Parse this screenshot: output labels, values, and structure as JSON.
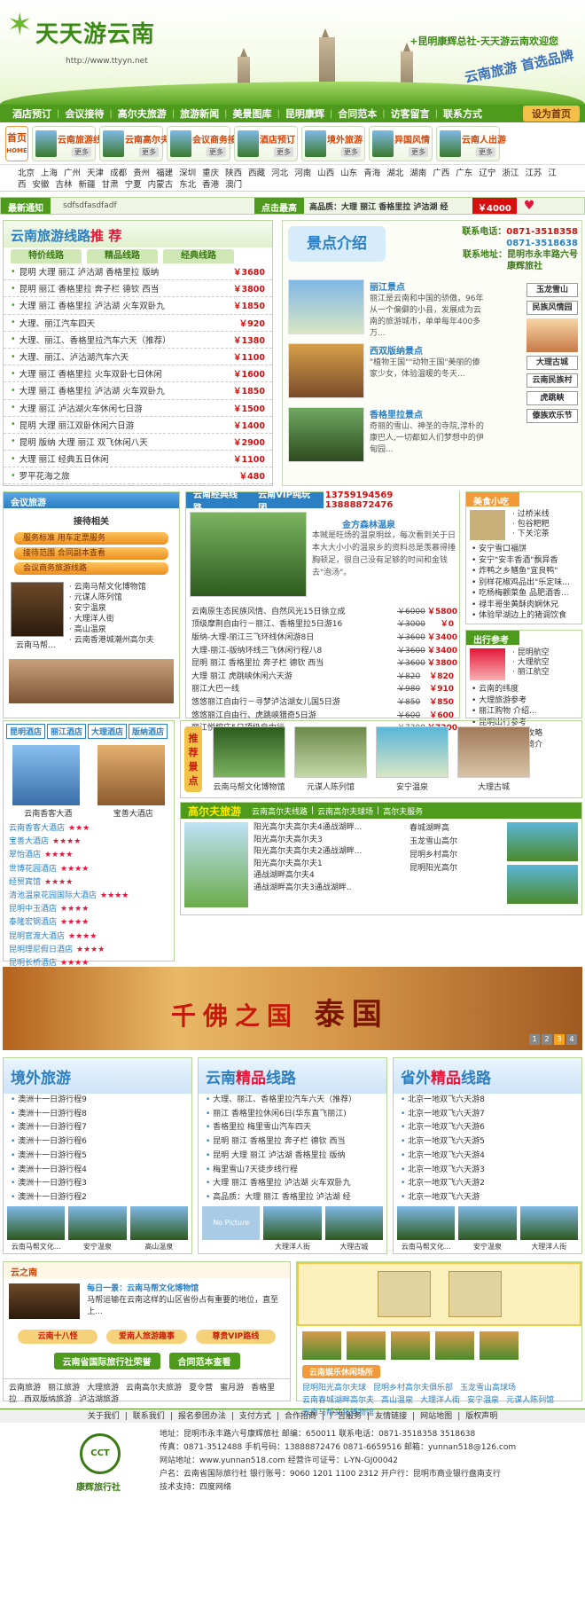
{
  "header": {
    "logo_text": "天天游云南",
    "logo_url": "http://www.ttyyn.net",
    "welcome": "+昆明康辉总社-天天游云南欢迎您",
    "slogan": "云南旅游 首选品牌"
  },
  "nav": {
    "items": [
      "酒店预订",
      "会议接待",
      "高尔夫旅游",
      "旅游新闻",
      "美景图库",
      "昆明康辉",
      "合同范本",
      "访客留言",
      "联系方式"
    ],
    "home": "设为首页"
  },
  "quick": {
    "home": "首页",
    "home2": "HOME",
    "boxes": [
      "云南旅游线路",
      "云南高尔夫",
      "会议商务接待",
      "酒店预订",
      "境外旅游",
      "异国风情",
      "云南人出游"
    ],
    "more": "更多"
  },
  "cities": [
    "北京",
    "上海",
    "广州",
    "天津",
    "成都",
    "贵州",
    "福建",
    "深圳",
    "重庆",
    "陕西",
    "西藏",
    "河北",
    "河南",
    "山西",
    "山东",
    "青海",
    "湖北",
    "湖南",
    "广西",
    "广东",
    "辽宁",
    "浙江",
    "江苏",
    "江西",
    "安徽",
    "吉林",
    "新疆",
    "甘肃",
    "宁夏",
    "内蒙古",
    "东北",
    "香港",
    "澳门"
  ],
  "notice": {
    "label": "最新通知",
    "value": "sdfsdfasdfadf",
    "hot": "点击最高",
    "hot_value": "高品质：大理 丽江 香格里拉 泸沽湖 经",
    "price": "￥4000"
  },
  "yn_routes": {
    "title1": "云南旅游线路",
    "title2": "推 荐",
    "tabs": [
      "特价线路",
      "精品线路",
      "经典线路"
    ],
    "items": [
      {
        "name": "昆明 大理 丽江 泸沽湖 香格里拉 版纳",
        "price": "￥3680"
      },
      {
        "name": "昆明 丽江 香格里拉 奔子栏 德钦 西当",
        "price": "￥3800"
      },
      {
        "name": "大理 丽江 香格里拉 泸沽湖 火车双卧九",
        "price": "￥1850"
      },
      {
        "name": "大理、丽江汽车四天",
        "price": "￥920"
      },
      {
        "name": "大理、丽江、香格里拉汽车六天（推荐）",
        "price": "￥1380"
      },
      {
        "name": "大理、丽江、泸沽湖汽车六天",
        "price": "￥1100"
      },
      {
        "name": "大理 丽江 香格里拉 火车双卧七日休闲",
        "price": "￥1600"
      },
      {
        "name": "大理 丽江 香格里拉 泸沽湖 火车双卧九",
        "price": "￥1850"
      },
      {
        "name": "大理 丽江 泸沽湖火车休闲七日游",
        "price": "￥1500"
      },
      {
        "name": "昆明 大理 丽江双卧休闲六日游",
        "price": "￥1400"
      },
      {
        "name": "昆明 版纳 大理 丽江 双飞休闲八天",
        "price": "￥2900"
      },
      {
        "name": "大理 丽江 经典五日休闲",
        "price": "￥1100"
      },
      {
        "name": "罗平花海之旅",
        "price": "￥480"
      }
    ]
  },
  "scenic": {
    "logo": "景点介绍",
    "tel_label": "联系电话：",
    "tel1": "0871-3518358",
    "tel2": "0871-3518638",
    "addr_label": "联系地址：",
    "addr": "昆明市永丰路六号康辉旅社",
    "spots": [
      {
        "title": "丽江景点",
        "desc": "丽江是云南和中国的骄傲，96年从一个偏僻的小县，发展成为云南的旅游城市，单单每年400多万..."
      },
      {
        "title": "西双版纳景点",
        "desc": "\"植物王国\"\"动物王国\"美丽的傣家少女，体验温暖的冬天..."
      },
      {
        "title": "香格里拉景点",
        "desc": "奇丽的雪山、神圣的寺院,淳朴的康巴人,一切都如人们梦想中的伊甸园..."
      }
    ],
    "buttons": [
      "玉龙雪山",
      "民族风情园",
      "大理古城",
      "云南民族村",
      "虎跳峡",
      "傣族欢乐节"
    ]
  },
  "meeting": {
    "title": "会议旅游",
    "sub": "接待相关",
    "btns": [
      "服务标准    用车定票服务",
      "接待范围  合同副本查看",
      "会议商务旅游线路"
    ],
    "list": [
      "云南马帮文化博物馆",
      "元谋人陈列馆",
      "安宁温泉",
      "大理洋人街",
      "高山温泉",
      "云南香港城潮州高尔夫"
    ],
    "caption": "云南马帮..."
  },
  "vip": {
    "tabs": [
      "云南经典线路",
      "云南VIP纯玩团"
    ],
    "tel": "13759194569  13888872476",
    "top_title": "金方森林温泉",
    "top_desc": "本贼是旺炀的温泉明丝，每次看到关于日本大大小小的温泉乡的资料总是羡慕得捶胸顿足，很自己没有足够的时间和金钱去\"泡汤\"。",
    "items": [
      {
        "name": "云南原生态民族风情、自然风光15日徐立成",
        "old": "￥6000",
        "price": "￥5800"
      },
      {
        "name": "顶级摩荆自由行－丽江、香格里拉5日游16",
        "old": "￥3000",
        "price": "￥0"
      },
      {
        "name": "版纳-大理-丽江三飞环线休闲游8日",
        "old": "￥3600",
        "price": "￥3400"
      },
      {
        "name": "大理-丽江-版纳环线三飞休闲行程八8",
        "old": "￥3600",
        "price": "￥3400"
      },
      {
        "name": "昆明 丽江 香格里拉 奔子栏 德钦 西当",
        "old": "￥3600",
        "price": "￥3800"
      },
      {
        "name": "大理 丽江 虎跳峡休闲六天游",
        "old": "￥820",
        "price": "￥820"
      },
      {
        "name": "丽江大巴一线",
        "old": "￥980",
        "price": "￥910"
      },
      {
        "name": "悠悠丽江自由行－寻梦泸沽湖女儿国5日游",
        "old": "￥850",
        "price": "￥850"
      },
      {
        "name": "悠悠丽江自由行、虎跳峡猎奇5日游",
        "old": "￥600",
        "price": "￥600"
      },
      {
        "name": "丽江悦榕庄5日顶级自由行",
        "old": "￥7300",
        "price": "￥7300"
      }
    ]
  },
  "food": {
    "title": "美食小吃",
    "top": [
      "过桥米线",
      "包谷粑粑",
      "下关沱茶"
    ],
    "list": [
      "安宁雪口福饼",
      "安宁\"安丰香酒\"飘异香",
      "炸鸭之乡鳝鱼\"宜良鸭\"",
      "别样花椒鸡品出\"乐定味...",
      "吃杨梅颧菜鱼 品肥酒香...",
      "禄丰哥坐黄酥肉娴休兄",
      "体验早湖边上的猪调饮食"
    ]
  },
  "travel": {
    "title": "出行参考",
    "top": [
      "昆明航空",
      "大理航空",
      "丽江航空"
    ],
    "list": [
      "云南的纬度",
      "大理旅游参考",
      "丽江购物 介绍...",
      "昆明出行参考",
      "昆明西山旅游攻略",
      "西双版纳气候简介"
    ]
  },
  "hotels": {
    "tabs": [
      "昆明酒店",
      "丽江酒店",
      "大理酒店",
      "版纳酒店"
    ],
    "pics": [
      "云南香客大酒",
      "宝善大酒店"
    ],
    "list": [
      {
        "name": "云南香客大酒店",
        "stars": "★★★"
      },
      {
        "name": "宝善大酒店",
        "stars": "★★★★"
      },
      {
        "name": "翠怡酒店",
        "stars": "★★★★"
      },
      {
        "name": "世博花园酒店",
        "stars": "★★★★"
      },
      {
        "name": "经贸宾馆",
        "stars": "★★★★"
      },
      {
        "name": "清池温泉花园国际大酒店",
        "stars": "★★★★"
      },
      {
        "name": "昆明中玉酒店",
        "stars": "★★★★"
      },
      {
        "name": "泰隆宏钢酒店",
        "stars": "★★★★"
      },
      {
        "name": "昆明官渡大酒店",
        "stars": "★★★★"
      },
      {
        "name": "昆明理尼假日酒店",
        "stars": "★★★★"
      },
      {
        "name": "昆明长桥酒店",
        "stars": "★★★★"
      }
    ]
  },
  "recommend": {
    "side": "推荐景点",
    "items": [
      "云南马帮文化博物馆",
      "元谋人陈列馆",
      "安宁温泉",
      "大理古城"
    ]
  },
  "golf": {
    "title": "高尔夫旅游",
    "tabs": [
      "云南高尔夫线路",
      "云南高尔夫球场",
      "高尔夫服务"
    ],
    "col1": [
      "阳光高尔夫高尔夫4通战湖畔...",
      "阳光高尔夫高尔夫3",
      "阳光高尔夫高尔夫2通战湖畔...",
      "阳光高尔夫高尔夫1",
      "通战湖畔高尔夫4",
      "通战湖畔高尔夫3通战湖畔.."
    ],
    "col2": [
      "春城湖畔高",
      "玉龙雪山高尔",
      "昆明乡村高尔",
      "昆明阳光高尔"
    ]
  },
  "banner": {
    "title1": "千佛之国",
    "title2": "泰国",
    "nums": [
      "1",
      "2",
      "3",
      "4"
    ]
  },
  "abroad": {
    "title": "境外旅游",
    "items": [
      "澳洲十一日游行程9",
      "澳洲十一日游行程8",
      "澳洲十一日游行程7",
      "澳洲十一日游行程6",
      "澳洲十一日游行程5",
      "澳洲十一日游行程4",
      "澳洲十一日游行程3",
      "澳洲十一日游行程2"
    ],
    "pics": [
      "云南马帮文化...",
      "安宁温泉",
      "高山温泉"
    ]
  },
  "boutique": {
    "t1": "云南",
    "t2": "精品",
    "t3": "线路",
    "items": [
      "大理、丽江、香格里拉汽车六天（推荐）",
      "丽江 香格里拉休闲6日(华东直飞丽江)",
      "香格里拉 梅里雪山汽车四天",
      "昆明 丽江 香格里拉 奔子栏 德钦 西当",
      "昆明 大理 丽江 泸沽湖 香格里拉 版纳",
      "梅里雪山7天徒步线行程",
      "大理 丽江 香格里拉 泸沽湖 火车双卧九",
      "高品质：大理 丽江 香格里拉 泸沽湖 经"
    ],
    "pics": [
      "No Picture",
      "大理洋人街",
      "大理古城"
    ]
  },
  "domestic": {
    "t1": "省外",
    "t2": "精品",
    "t3": "线路",
    "items": [
      "北京一地双飞六天游8",
      "北京一地双飞六天游7",
      "北京一地双飞六天游6",
      "北京一地双飞六天游5",
      "北京一地双飞六天游4",
      "北京一地双飞六天游3",
      "北京一地双飞六天游2",
      "北京一地双飞六天游"
    ],
    "pics": [
      "云南马帮文化...",
      "安宁温泉",
      "大理洋人街"
    ]
  },
  "yunnan_south": {
    "title": "云之南",
    "daily": "每日一景：云南马帮文化博物馆",
    "desc": "马帮运输在云南这样的山区省份占有重要的地位，直至上...",
    "btns": [
      "云南十八怪",
      "爱南人旅游趣事",
      "尊贵VIP路线"
    ],
    "btns2": [
      "云南省国际旅行社荣誉",
      "合同范本查看"
    ],
    "links": [
      "云南旅游",
      "丽江旅游",
      "大理旅游",
      "云南高尔夫旅游",
      "夏令营",
      "蜜月游",
      "香格里拉",
      "西双版纳旅游",
      "泸沽湖旅游"
    ]
  },
  "entertainment": {
    "title": "云南娱乐休闲场所",
    "links": [
      "昆明阳光高尔夫球",
      "昆明乡村高尔夫俱乐部",
      "玉龙雪山高球场",
      "云南春城湖畔高尔夫",
      "高山温泉",
      "大理洋人街",
      "安宁温泉",
      "元谋人陈列馆",
      "云南马帮文化博物馆"
    ]
  },
  "footer": {
    "links": [
      "关于我们",
      "联系我们",
      "报名参团办法",
      "支付方式",
      "合作招商",
      "广告服务",
      "友情链接",
      "网站地图",
      "版权声明"
    ],
    "logo": "CCT",
    "company": "康辉旅行社",
    "lines": [
      "地址：昆明市永丰路六号康辉旅社 邮编：650011 联系电话：0871-3518358 3518638",
      "传真：0871-3512488 手机号码：13888872476 0871-6659516 邮箱：yunnan518@126.com",
      "网站地址：www.yunnan518.com 经营许可证号：L-YN-GJ00042",
      "户名：云南省国际旅行社 银行账号：9060 1201 1100 2312 开户行：昆明市商业银行盘南支行",
      "技术支持：四度网络"
    ]
  }
}
